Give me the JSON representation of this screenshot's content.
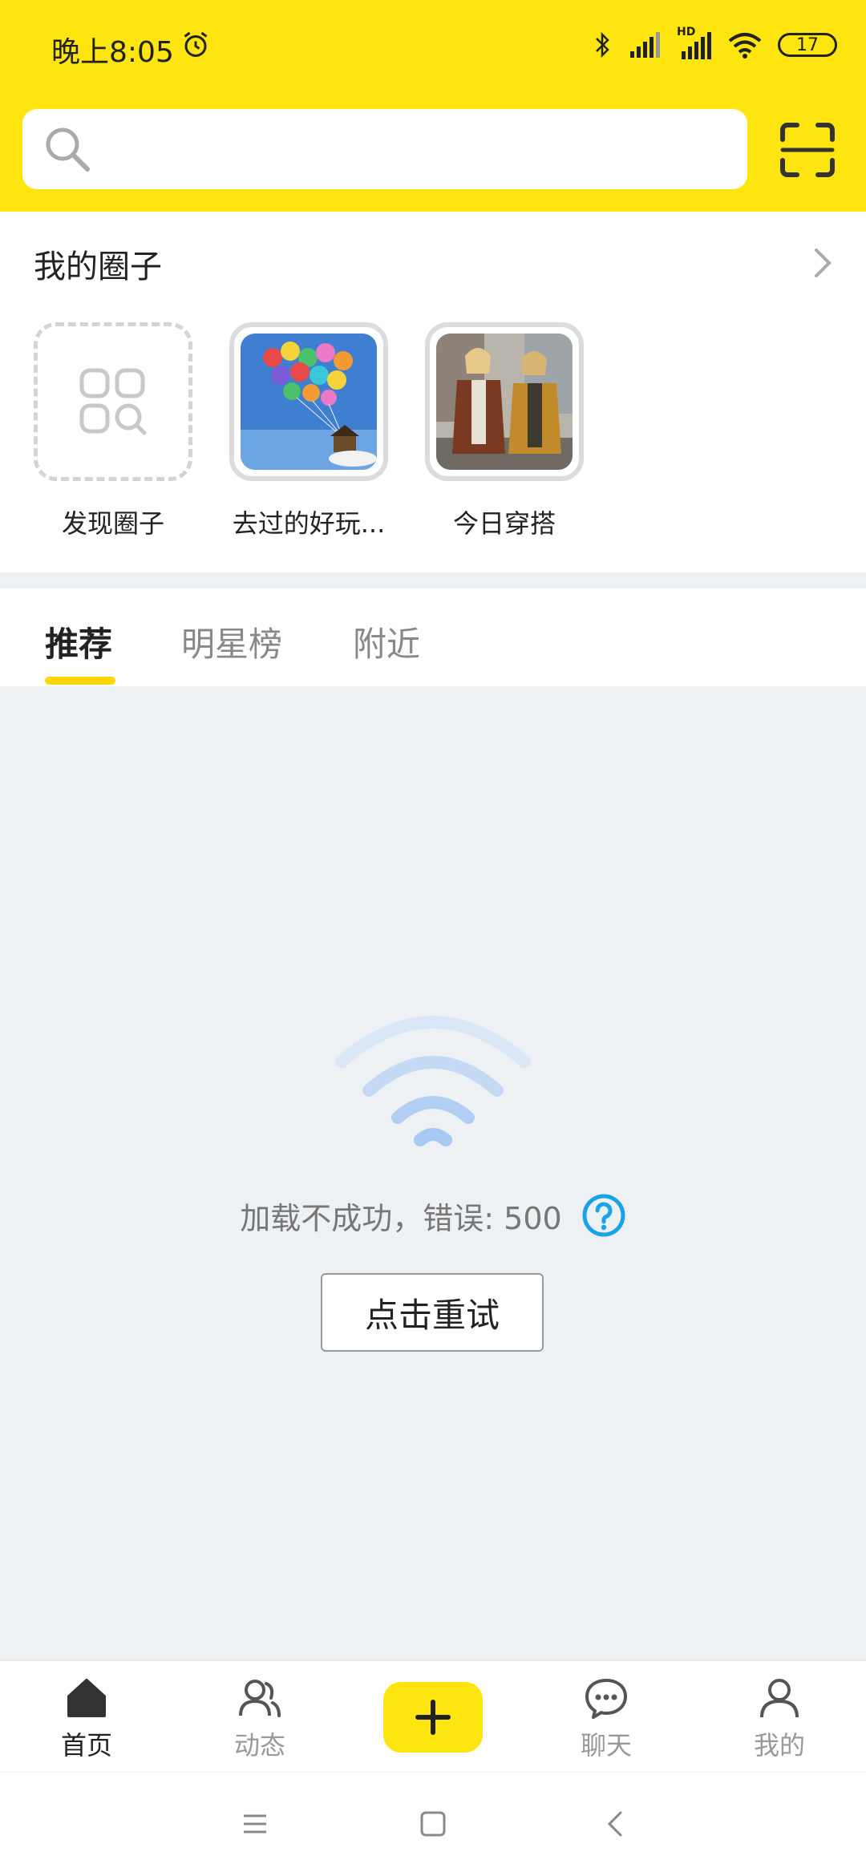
{
  "status_bar": {
    "time": "晚上8:05",
    "battery": "17",
    "network_label": "HD"
  },
  "search": {
    "placeholder": ""
  },
  "my_circles": {
    "title": "我的圈子",
    "items": [
      {
        "label": "发现圈子",
        "icon": "discover-circle-icon"
      },
      {
        "label": "去过的好玩...",
        "image": "balloon-house-photo"
      },
      {
        "label": "今日穿搭",
        "image": "two-women-fashion-photo"
      }
    ]
  },
  "tabs": [
    {
      "label": "推荐",
      "active": true
    },
    {
      "label": "明星榜",
      "active": false
    },
    {
      "label": "附近",
      "active": false
    }
  ],
  "error": {
    "message": "加载不成功，错误: 500",
    "retry_label": "点击重试"
  },
  "bottom_nav": [
    {
      "label": "首页",
      "icon": "home-icon",
      "active": true
    },
    {
      "label": "动态",
      "icon": "users-icon",
      "active": false
    },
    {
      "label": "",
      "icon": "plus-icon",
      "active": false
    },
    {
      "label": "聊天",
      "icon": "chat-icon",
      "active": false
    },
    {
      "label": "我的",
      "icon": "profile-icon",
      "active": false
    }
  ],
  "colors": {
    "brand_yellow": "#ffe510",
    "tab_indicator": "#ffd600",
    "help_blue": "#1aa3e8",
    "wifi_blue": "#a9c9f5"
  }
}
